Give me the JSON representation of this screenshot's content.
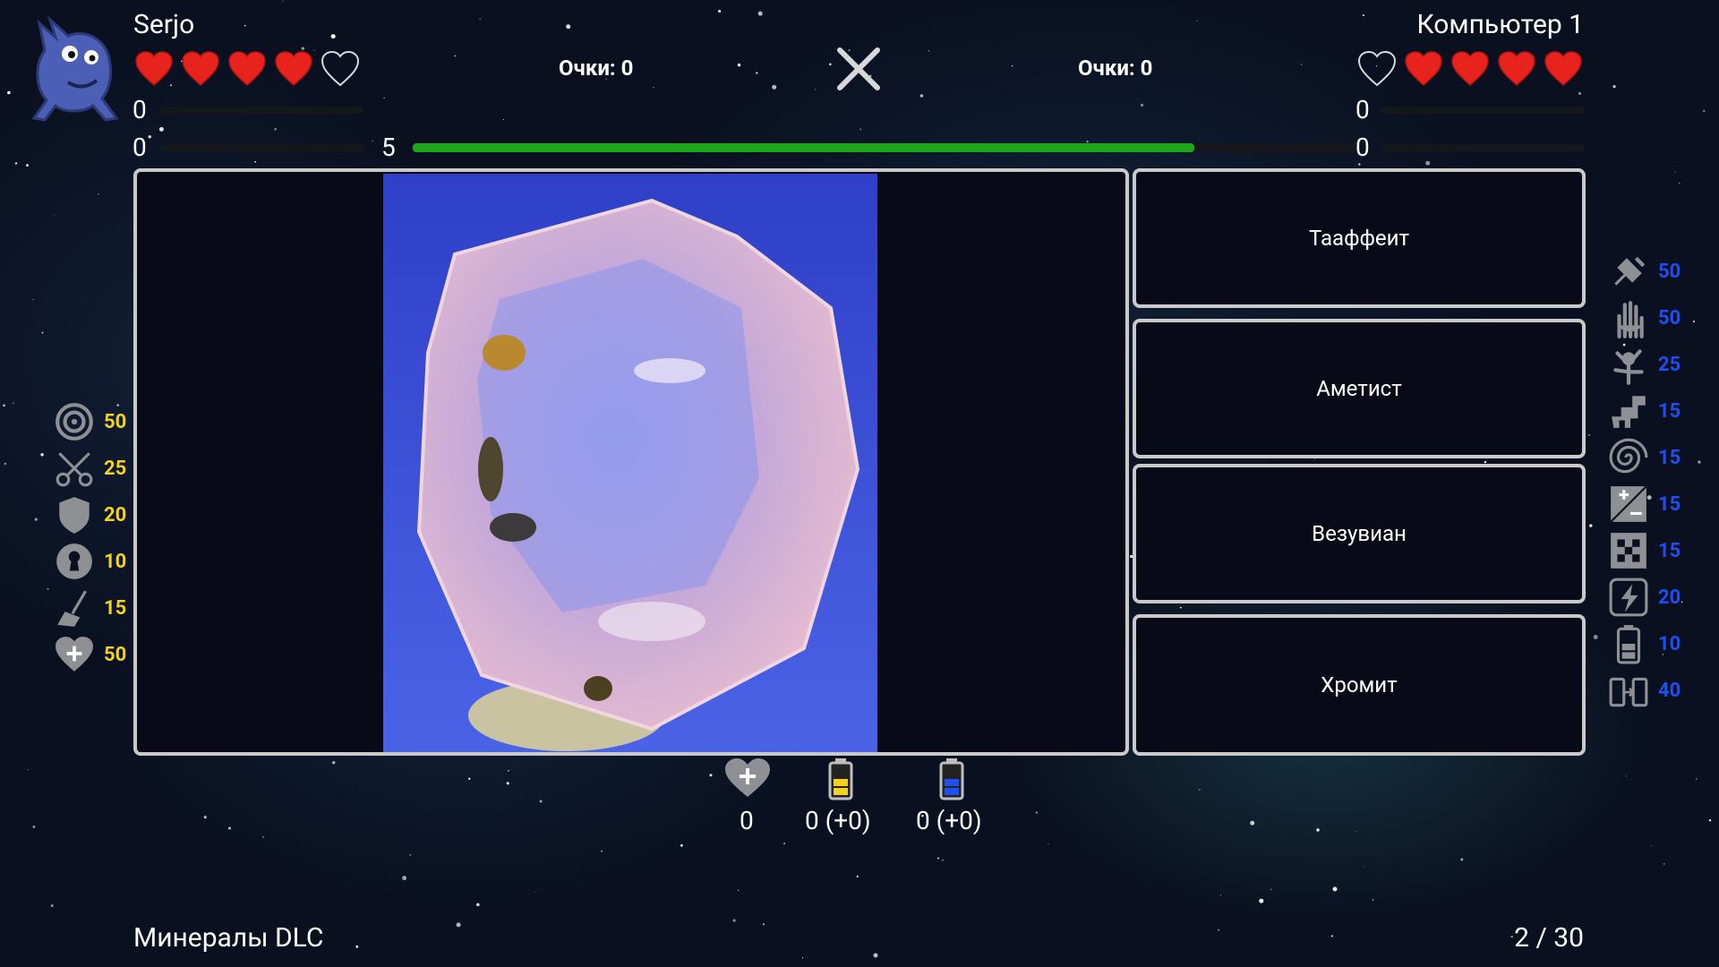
{
  "player1": {
    "name": "Serjo",
    "score_label": "Очки: 0",
    "hearts": [
      "full",
      "full",
      "full",
      "full",
      "empty"
    ],
    "bar_top_value": "0",
    "bar_bottom_value": "0"
  },
  "player2": {
    "name": "Компьютер 1",
    "score_label": "Очки: 0",
    "hearts": [
      "empty",
      "full",
      "full",
      "full",
      "full"
    ],
    "bar_top_value": "0",
    "bar_bottom_value": "0"
  },
  "timer": {
    "value": "5",
    "progress": 0.83,
    "color": "#1fa51c"
  },
  "answers": [
    "Тааффеит",
    "Аметист",
    "Везувиан",
    "Хромит"
  ],
  "left_powerups": [
    {
      "icon": "target-icon",
      "value": "50"
    },
    {
      "icon": "scissors-icon",
      "value": "25"
    },
    {
      "icon": "shield-icon",
      "value": "20"
    },
    {
      "icon": "keyhole-icon",
      "value": "10"
    },
    {
      "icon": "broom-icon",
      "value": "15"
    },
    {
      "icon": "heart-plus-icon",
      "value": "50"
    }
  ],
  "right_powerups": [
    {
      "icon": "satellite-icon",
      "value": "50"
    },
    {
      "icon": "hand-icon",
      "value": "50"
    },
    {
      "icon": "plant-creature-icon",
      "value": "25"
    },
    {
      "icon": "dinosaur-icon",
      "value": "15"
    },
    {
      "icon": "spiral-icon",
      "value": "15"
    },
    {
      "icon": "plus-minus-icon",
      "value": "15"
    },
    {
      "icon": "checker-icon",
      "value": "15"
    },
    {
      "icon": "lightning-icon",
      "value": "20"
    },
    {
      "icon": "battery-icon",
      "value": "10"
    },
    {
      "icon": "battery-transfer-icon",
      "value": "40"
    }
  ],
  "resources": {
    "hearts_count": "0",
    "yellow_battery": "0 (+0)",
    "blue_battery": "0 (+0)"
  },
  "colors": {
    "yellow": "#f2d21e",
    "blue": "#1e4ff2",
    "heart": "#e8221c"
  },
  "footer": {
    "category": "Минералы DLC",
    "progress": "2 / 30"
  }
}
